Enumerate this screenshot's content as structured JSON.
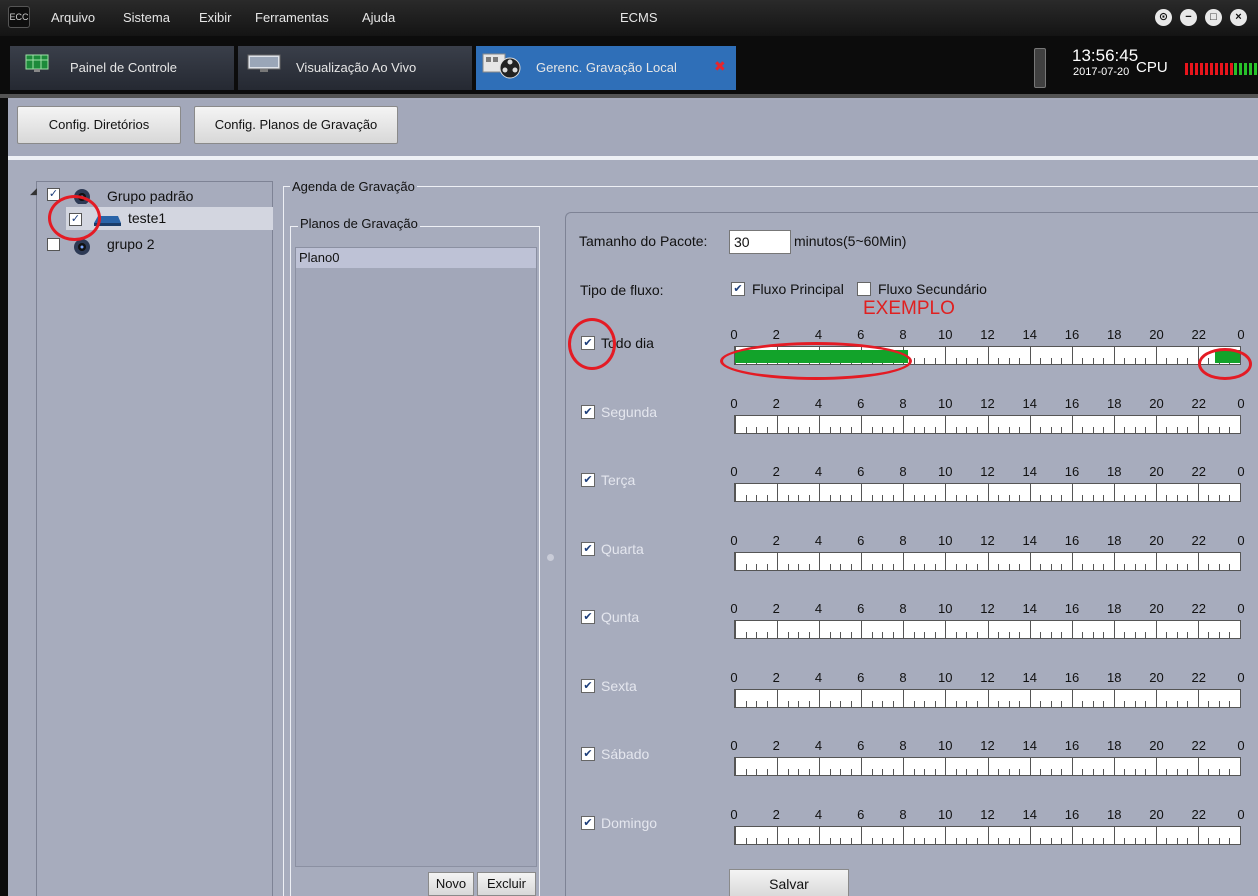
{
  "titlebar": {
    "logo_text": "ECC",
    "menu": [
      "Arquivo",
      "Sistema",
      "Exibir",
      "Ferramentas",
      "Ajuda"
    ],
    "title": "ECMS",
    "window_buttons": [
      "lock-icon",
      "minimize-icon",
      "maximize-icon",
      "close-icon"
    ]
  },
  "tabs": [
    {
      "label": "Painel de Controle",
      "icon": "dashboard-icon"
    },
    {
      "label": "Visualização Ao Vivo",
      "icon": "monitor-icon"
    },
    {
      "label": "Gerenc. Gravação Local",
      "icon": "film-reel-icon",
      "active": true,
      "close": "✖"
    }
  ],
  "status": {
    "time": "13:56:45",
    "date": "2017-07-20",
    "cpu_label": "CPU"
  },
  "toolbar": {
    "dirs_label": "Config. Diretórios",
    "plans_label": "Config. Planos de Gravação"
  },
  "tree": {
    "groups": [
      {
        "label": "Grupo padrão",
        "checked": true,
        "expanded": true,
        "expander": "◢"
      },
      {
        "label": "teste1",
        "checked": true
      },
      {
        "label": "grupo 2",
        "checked": false
      }
    ]
  },
  "agenda": {
    "legend": "Agenda de Gravação",
    "plans_legend": "Planos de Gravação",
    "plans": [
      "Plano0"
    ],
    "new_label": "Novo",
    "delete_label": "Excluir"
  },
  "schedule": {
    "packet_label": "Tamanho do Pacote:",
    "packet_value": "30",
    "packet_unit": "minutos(5~60Min)",
    "stream_label": "Tipo de fluxo:",
    "stream_main": "Fluxo Principal",
    "stream_main_checked": true,
    "stream_sub": "Fluxo Secundário",
    "stream_sub_checked": false,
    "annotation": "EXEMPLO",
    "hours": [
      "0",
      "2",
      "4",
      "6",
      "8",
      "10",
      "12",
      "14",
      "16",
      "18",
      "20",
      "22",
      "0"
    ],
    "days": [
      {
        "label": "Todo dia",
        "checked": true,
        "enabled": true,
        "ranges": [
          [
            0,
            8.2
          ],
          [
            22.8,
            24
          ]
        ]
      },
      {
        "label": "Segunda",
        "checked": true,
        "enabled": false,
        "ranges": []
      },
      {
        "label": "Terça",
        "checked": true,
        "enabled": false,
        "ranges": []
      },
      {
        "label": "Quarta",
        "checked": true,
        "enabled": false,
        "ranges": []
      },
      {
        "label": "Qunta",
        "checked": true,
        "enabled": false,
        "ranges": []
      },
      {
        "label": "Sexta",
        "checked": true,
        "enabled": false,
        "ranges": []
      },
      {
        "label": "Sábado",
        "checked": true,
        "enabled": false,
        "ranges": []
      },
      {
        "label": "Domingo",
        "checked": true,
        "enabled": false,
        "ranges": []
      }
    ],
    "save_label": "Salvar"
  },
  "colors": {
    "record_fill": "#12a32a",
    "annotation_red": "#e02020",
    "active_tab": "#2f6fb8"
  }
}
